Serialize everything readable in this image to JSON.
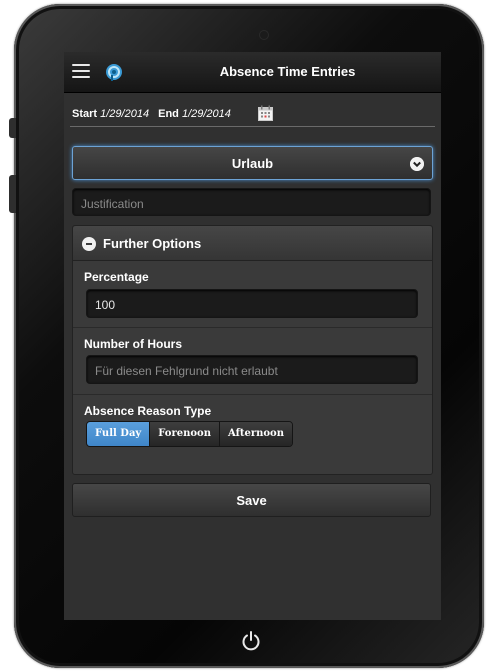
{
  "header": {
    "title": "Absence Time Entries",
    "menu_icon": "hamburger-icon",
    "app_icon": "app-logo-icon"
  },
  "dates": {
    "start_label": "Start",
    "start_value": "1/29/2014",
    "end_label": "End",
    "end_value": "1/29/2014",
    "calendar_icon": "calendar-icon"
  },
  "reason_select": {
    "selected": "Urlaub",
    "icon": "chevron-down-icon"
  },
  "justification": {
    "placeholder": "Justification",
    "value": ""
  },
  "further_options": {
    "title": "Further Options",
    "percentage": {
      "label": "Percentage",
      "value": "100"
    },
    "hours": {
      "label": "Number of Hours",
      "placeholder": "Für diesen Fehlgrund nicht erlaubt"
    },
    "absence_type": {
      "label": "Absence Reason Type",
      "options": [
        "Full Day",
        "Forenoon",
        "Afternoon"
      ],
      "selected": "Full Day"
    }
  },
  "actions": {
    "save_label": "Save"
  },
  "colors": {
    "accent": "#4a90d2",
    "screen_bg": "#303030",
    "header_bg": "#151515"
  }
}
